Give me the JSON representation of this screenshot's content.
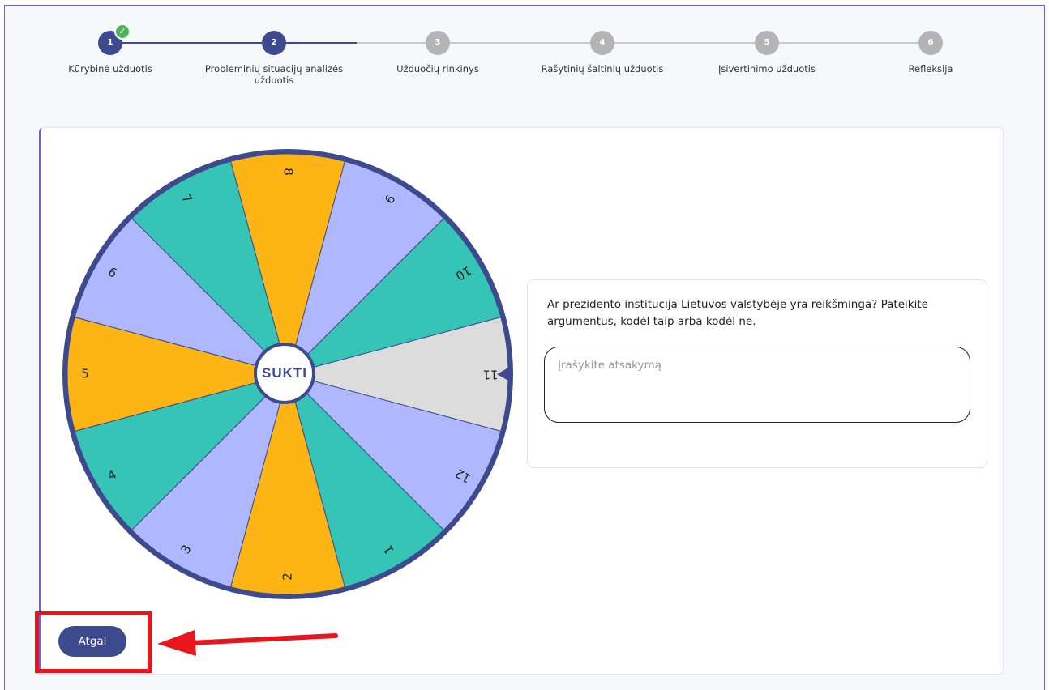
{
  "stepper": {
    "steps": [
      {
        "number": "1",
        "label": "Kūrybinė užduotis",
        "state": "completed"
      },
      {
        "number": "2",
        "label": "Probleminių situacijų analizės užduotis",
        "state": "active"
      },
      {
        "number": "3",
        "label": "Užduočių rinkinys",
        "state": "inactive"
      },
      {
        "number": "4",
        "label": "Rašytinių šaltinių užduotis",
        "state": "inactive"
      },
      {
        "number": "5",
        "label": "Įsivertinimo užduotis",
        "state": "inactive"
      },
      {
        "number": "6",
        "label": "Refleksija",
        "state": "inactive"
      }
    ],
    "check_icon": "check-icon"
  },
  "wheel": {
    "spin_label": "SUKTI",
    "segments": [
      {
        "label": "1",
        "color": "#35c4b5"
      },
      {
        "label": "2",
        "color": "#fdb515"
      },
      {
        "label": "3",
        "color": "#b0b8fd"
      },
      {
        "label": "4",
        "color": "#35c4b5"
      },
      {
        "label": "5",
        "color": "#fdb515"
      },
      {
        "label": "6",
        "color": "#b0b8fd"
      },
      {
        "label": "7",
        "color": "#35c4b5"
      },
      {
        "label": "8",
        "color": "#fdb515"
      },
      {
        "label": "9",
        "color": "#b0b8fd"
      },
      {
        "label": "10",
        "color": "#35c4b5"
      },
      {
        "label": "11",
        "color": "#dcdcdc"
      },
      {
        "label": "12",
        "color": "#b0b8fd"
      }
    ],
    "rim_color": "#3d4a8e",
    "pointer_icon": "pointer-triangle-icon"
  },
  "question": {
    "text": "Ar prezidento institucija Lietuvos valstybėje yra reikšminga? Pateikite argumentus, kodėl taip arba kodėl ne.",
    "answer_placeholder": "Įrašykite atsakymą",
    "answer_value": ""
  },
  "actions": {
    "back_label": "Atgal"
  },
  "colors": {
    "primary": "#3d4a8e",
    "inactive_step": "#b4b4b4",
    "highlight": "#e8161c",
    "accent_border": "#6a5ee6"
  }
}
